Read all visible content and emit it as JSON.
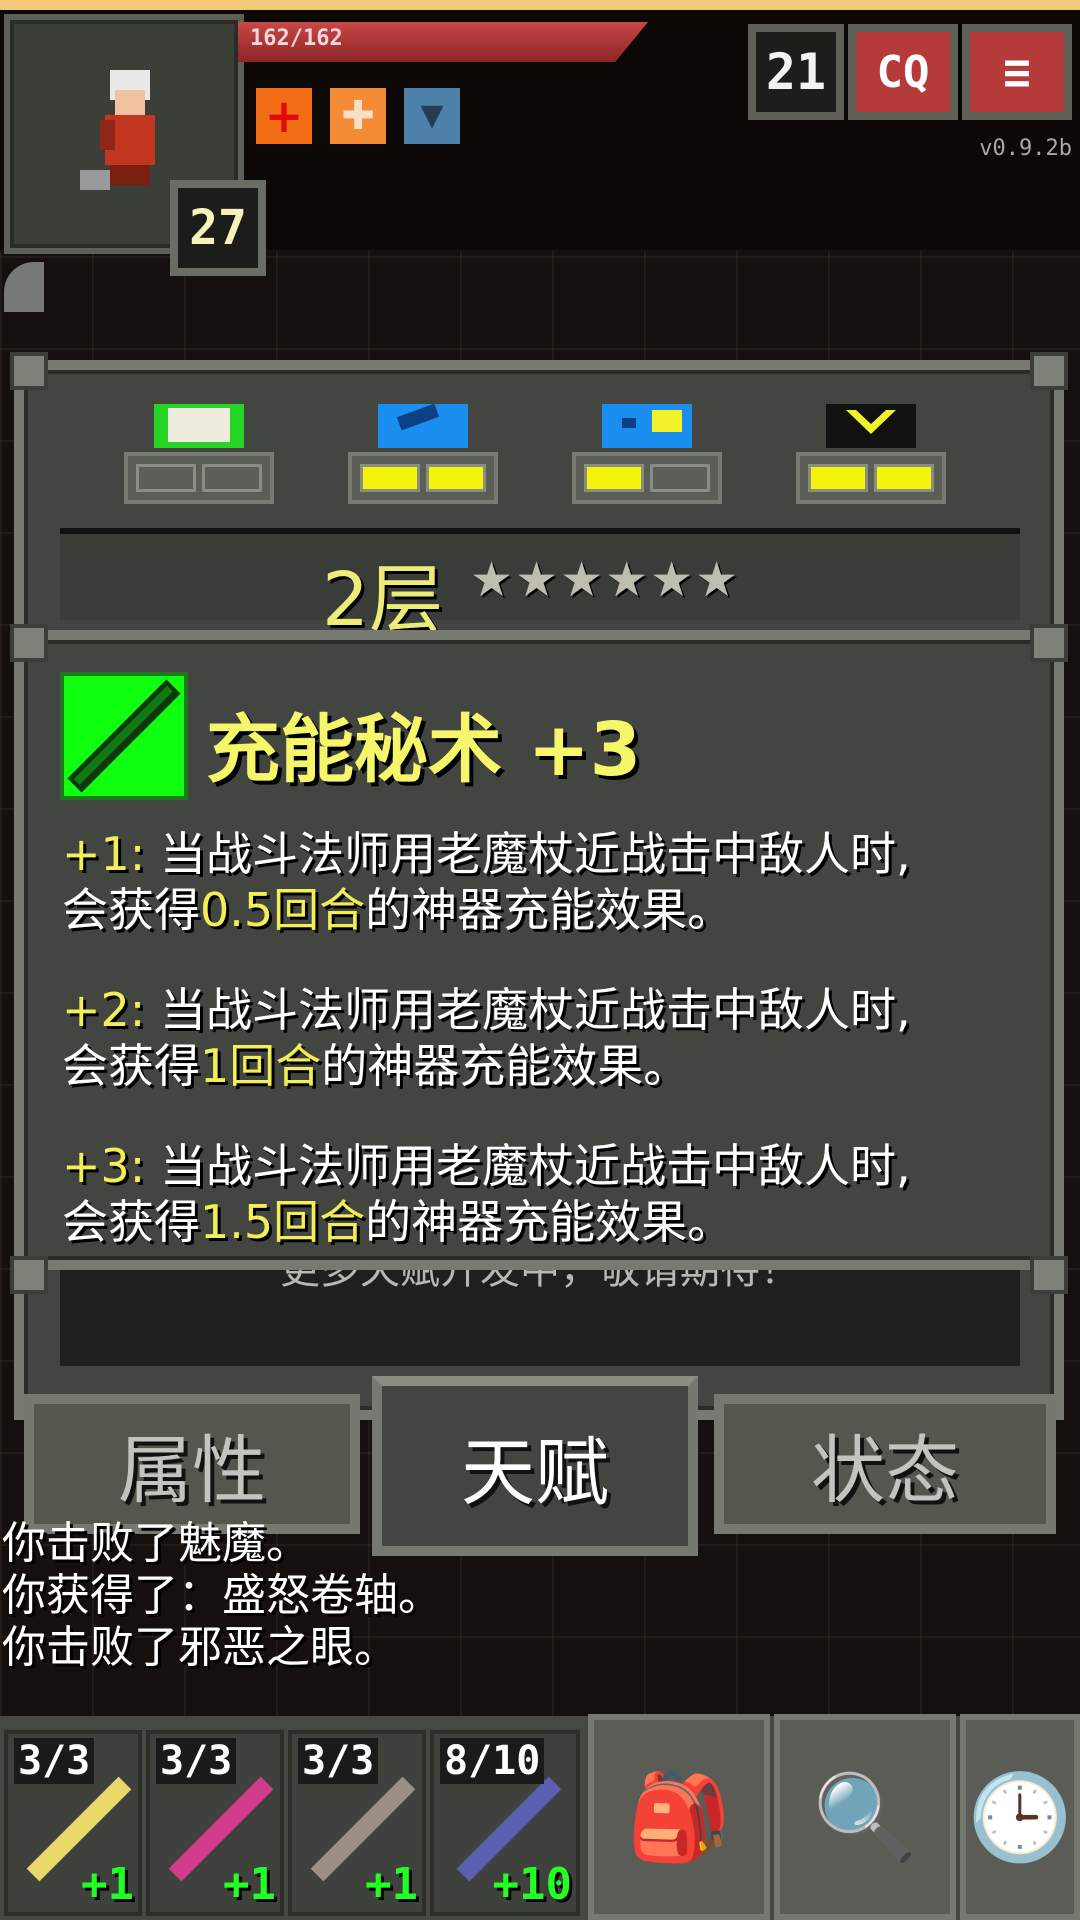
{
  "hud": {
    "hp": "162/162",
    "hp_fraction": 1.0,
    "hero_level": "27",
    "depth": "21",
    "journal_label": "CQ",
    "menu_label": "≡",
    "version": "v0.9.2b"
  },
  "buffs": [
    {
      "icon": "rage-cross-icon",
      "color": "#f36d17"
    },
    {
      "icon": "blessed-icon",
      "color": "#f38a36"
    },
    {
      "icon": "shielded-icon",
      "color": "#4e82ab"
    }
  ],
  "talents_window": {
    "tier_label": "2层",
    "tier_stars": "★★★★★★",
    "slots": [
      {
        "icon": "green-talent-icon",
        "points_filled": 0,
        "points_max": 2
      },
      {
        "icon": "blue-staff-talent-icon",
        "points_filled": 2,
        "points_max": 2
      },
      {
        "icon": "blue-tome-talent-icon",
        "points_filled": 1,
        "points_max": 2
      },
      {
        "icon": "yellow-chevron-talent-icon",
        "points_filled": 2,
        "points_max": 2
      }
    ],
    "footer_note": "更多天赋开发中，敬请期待！"
  },
  "talent_popup": {
    "title": "充能秘术 +3",
    "effects": [
      {
        "prefix": "+1:",
        "line1": "当战斗法师用老魔杖近战击中敌人时,",
        "pre": "会获得",
        "highlight": "0.5回合",
        "post": "的神器充能效果。"
      },
      {
        "prefix": "+2:",
        "line1": "当战斗法师用老魔杖近战击中敌人时,",
        "pre": "会获得",
        "highlight": "1回合",
        "post": "的神器充能效果。"
      },
      {
        "prefix": "+3:",
        "line1": "当战斗法师用老魔杖近战击中敌人时,",
        "pre": "会获得",
        "highlight": "1.5回合",
        "post": "的神器充能效果。"
      }
    ]
  },
  "tabs": [
    {
      "label": "属性",
      "active": false
    },
    {
      "label": "天赋",
      "active": true
    },
    {
      "label": "状态",
      "active": false
    }
  ],
  "game_log": [
    "你击败了魅魔。",
    "你获得了：盛怒卷轴。",
    "你击败了邪恶之眼。"
  ],
  "quickslots": [
    {
      "charges": "3/3",
      "upgrade": "+1",
      "color": "#e8d86a"
    },
    {
      "charges": "3/3",
      "upgrade": "+1",
      "color": "#d33c8a"
    },
    {
      "charges": "3/3",
      "upgrade": "+1",
      "color": "#9c8f86"
    },
    {
      "charges": "8/10",
      "upgrade": "+10",
      "color": "#5b5fb0"
    }
  ],
  "toolbar": [
    {
      "icon": "backpack-icon",
      "glyph": "🎒"
    },
    {
      "icon": "search-icon",
      "glyph": "🔍"
    },
    {
      "icon": "wait-clock-icon",
      "glyph": "🕒"
    }
  ]
}
